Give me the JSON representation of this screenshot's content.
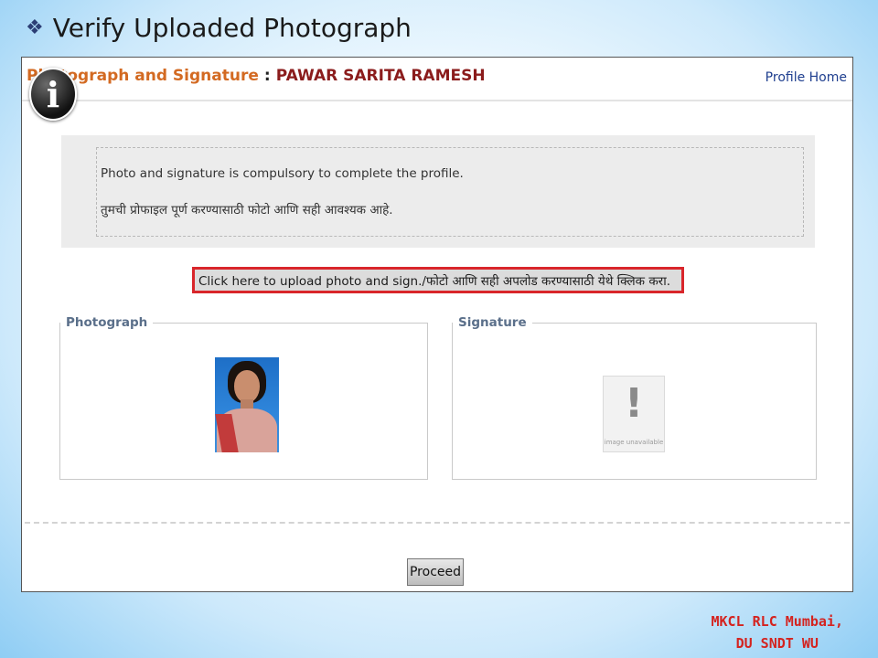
{
  "slide": {
    "title": "Verify Uploaded Photograph",
    "bullet_icon": "diamond-bullet-icon"
  },
  "header": {
    "label": "Photograph and Signature",
    "separator": ":",
    "name": "PAWAR SARITA RAMESH",
    "profile_home": "Profile Home"
  },
  "info": {
    "icon": "info-icon",
    "line1": "Photo and signature is compulsory to complete the profile.",
    "line2": "तुमची प्रोफाइल पूर्ण करण्यासाठी फोटो आणि सही आवश्यक आहे."
  },
  "upload_link": "Click here to upload photo and sign./फोटो आणि सही अपलोड करण्यासाठी येथे क्लिक करा.",
  "photo_panel": {
    "legend": "Photograph"
  },
  "sign_panel": {
    "legend": "Signature",
    "placeholder_mark": "!",
    "placeholder_caption": "image unavailable"
  },
  "proceed_label": "Proceed",
  "footer": {
    "line1": "MKCL RLC Mumbai,",
    "line2": "DU SNDT WU"
  },
  "colors": {
    "label_orange": "#d36a22",
    "name_maroon": "#8b1c1c",
    "link_blue": "#1f3f8f",
    "highlight_red": "#d9262b",
    "footer_red": "#d4231f"
  }
}
